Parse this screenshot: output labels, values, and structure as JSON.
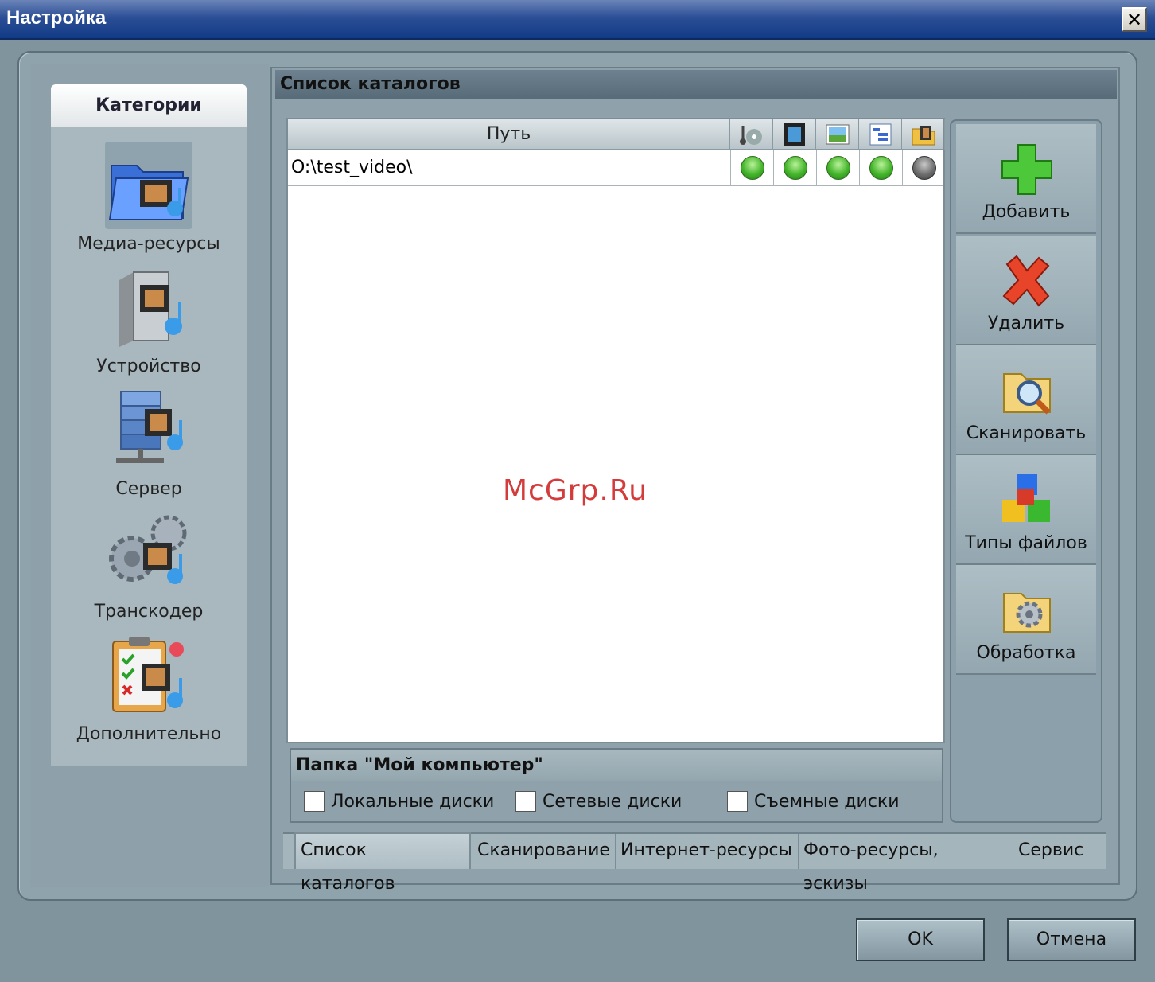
{
  "window": {
    "title": "Настройка",
    "close_label": "✕"
  },
  "categories": {
    "header": "Категории",
    "items": [
      {
        "label": "Медиа-ресурсы",
        "icon": "media-folder-icon"
      },
      {
        "label": "Устройство",
        "icon": "device-icon"
      },
      {
        "label": "Сервер",
        "icon": "server-icon"
      },
      {
        "label": "Транскодер",
        "icon": "transcoder-gears-icon"
      },
      {
        "label": "Дополнительно",
        "icon": "checklist-icon"
      }
    ]
  },
  "main": {
    "title": "Список каталогов",
    "table": {
      "path_header": "Путь",
      "column_icons": [
        "audio-icon",
        "video-icon",
        "image-icon",
        "playlist-icon",
        "folder-media-icon"
      ],
      "rows": [
        {
          "path": "O:\\test_video\\",
          "states": [
            "on",
            "on",
            "on",
            "on",
            "off"
          ]
        }
      ]
    },
    "watermark": "McGrp.Ru"
  },
  "side_buttons": [
    {
      "label": "Добавить",
      "icon": "add-plus-icon"
    },
    {
      "label": "Удалить",
      "icon": "delete-x-icon"
    },
    {
      "label": "Сканировать",
      "icon": "scan-folder-icon"
    },
    {
      "label": "Типы файлов",
      "icon": "file-types-cubes-icon"
    },
    {
      "label": "Обработка",
      "icon": "processing-folder-icon"
    }
  ],
  "my_computer": {
    "title": "Папка \"Мой компьютер\"",
    "options": [
      {
        "label": "Локальные диски",
        "checked": false
      },
      {
        "label": "Сетевые диски",
        "checked": false
      },
      {
        "label": "Съемные диски",
        "checked": false
      }
    ]
  },
  "tabs": [
    "Список каталогов",
    "Сканирование",
    "Интернет-ресурсы",
    "Фото-ресурсы, эскизы",
    "Сервис"
  ],
  "dialog": {
    "ok_label": "OK",
    "cancel_label": "Отмена"
  },
  "colors": {
    "titlebar": "#123b86",
    "status_on": "#45b52b",
    "status_off": "#6e6e6e",
    "watermark": "#d43c3c"
  }
}
